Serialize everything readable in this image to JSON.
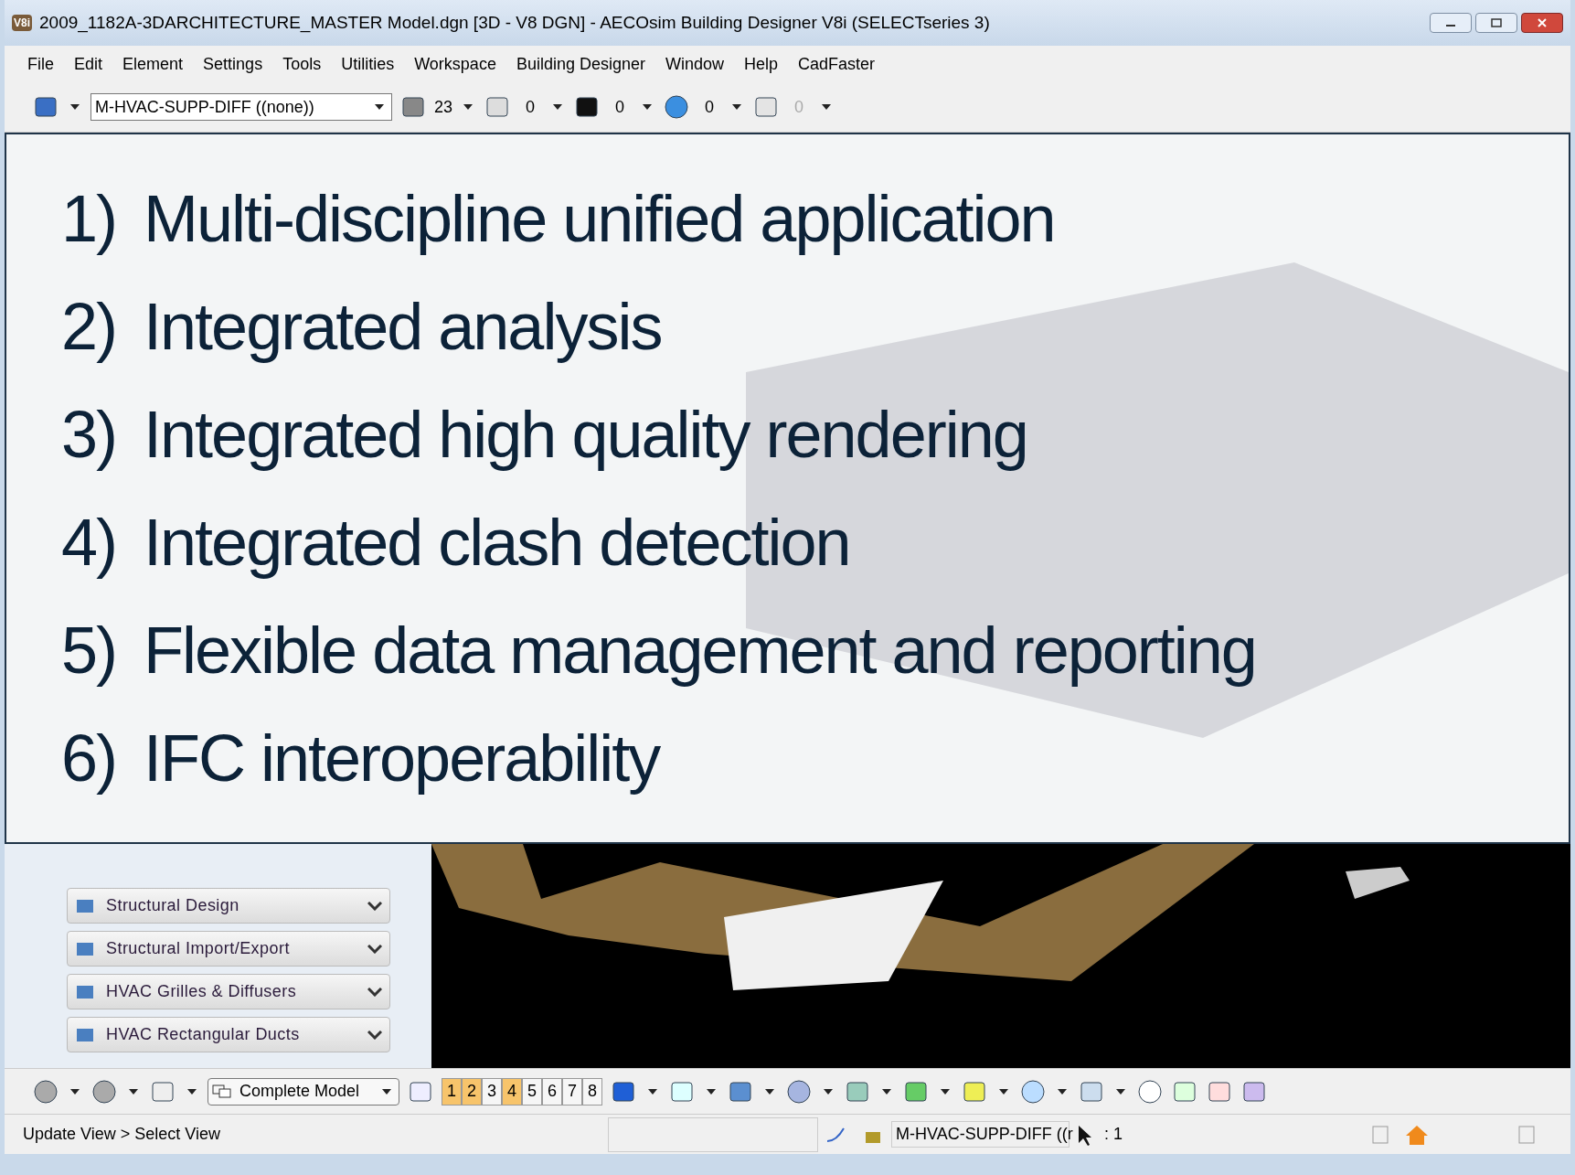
{
  "window": {
    "title": "2009_1182A-3DARCHITECTURE_MASTER Model.dgn [3D - V8 DGN] - AECOsim Building Designer V8i (SELECTseries 3)",
    "app_badge": "V8i"
  },
  "menu": [
    "File",
    "Edit",
    "Element",
    "Settings",
    "Tools",
    "Utilities",
    "Workspace",
    "Building Designer",
    "Window",
    "Help",
    "CadFaster"
  ],
  "attributes_toolbar": {
    "level": "M-HVAC-SUPP-DIFF ((none))",
    "color_index": "23",
    "style": "0",
    "weight": "0",
    "transparency": "0",
    "priority": "0"
  },
  "overlay": {
    "items": [
      {
        "number": "1)",
        "text": "Multi-discipline unified application"
      },
      {
        "number": "2)",
        "text": "Integrated analysis"
      },
      {
        "number": "3)",
        "text": "Integrated high quality rendering"
      },
      {
        "number": "4)",
        "text": "Integrated clash detection"
      },
      {
        "number": "5)",
        "text": "Flexible data management and reporting"
      },
      {
        "number": "6)",
        "text": "IFC interoperability"
      }
    ]
  },
  "task_panel": {
    "groups": [
      "Structural Design",
      "Structural Import/Export",
      "HVAC Grilles & Diffusers",
      "HVAC Rectangular Ducts"
    ]
  },
  "view_toolbar": {
    "view": "Complete Model",
    "views": [
      {
        "label": "1",
        "on": true
      },
      {
        "label": "2",
        "on": true
      },
      {
        "label": "3",
        "on": false
      },
      {
        "label": "4",
        "on": true
      },
      {
        "label": "5",
        "on": false
      },
      {
        "label": "6",
        "on": false
      },
      {
        "label": "7",
        "on": false
      },
      {
        "label": "8",
        "on": false
      }
    ]
  },
  "status_bar": {
    "message": "Update View > Select View",
    "level": "M-HVAC-SUPP-DIFF ((r",
    "scale": ": 1"
  }
}
